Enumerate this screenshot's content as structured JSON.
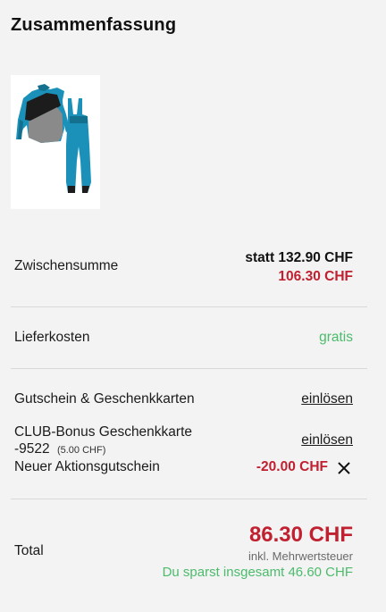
{
  "summary": {
    "title": "Zusammenfassung"
  },
  "product": {
    "image_icon": "ski-suit-image"
  },
  "subtotal": {
    "label": "Zwischensumme",
    "original": "statt 132.90 CHF",
    "price": "106.30 CHF"
  },
  "shipping": {
    "label": "Lieferkosten",
    "value": "gratis"
  },
  "voucher": {
    "label": "Gutschein & Geschenkkarten",
    "action": "einlösen"
  },
  "club": {
    "line1": "CLUB-Bonus Geschenkkarte",
    "line2": "-9522",
    "amount": "(5.00 CHF)",
    "action": "einlösen"
  },
  "promo": {
    "label": "Neuer Aktionsgutschein",
    "value": "-20.00 CHF",
    "remove_icon": "close-icon"
  },
  "total": {
    "label": "Total",
    "price": "86.30 CHF",
    "vat": "inkl. Mehrwertsteuer",
    "savings": "Du sparst insgesamt 46.60 CHF"
  },
  "colors": {
    "sale_red": "#c0202f",
    "success_green": "#4cbb6c",
    "background": "#f3f3f3"
  }
}
